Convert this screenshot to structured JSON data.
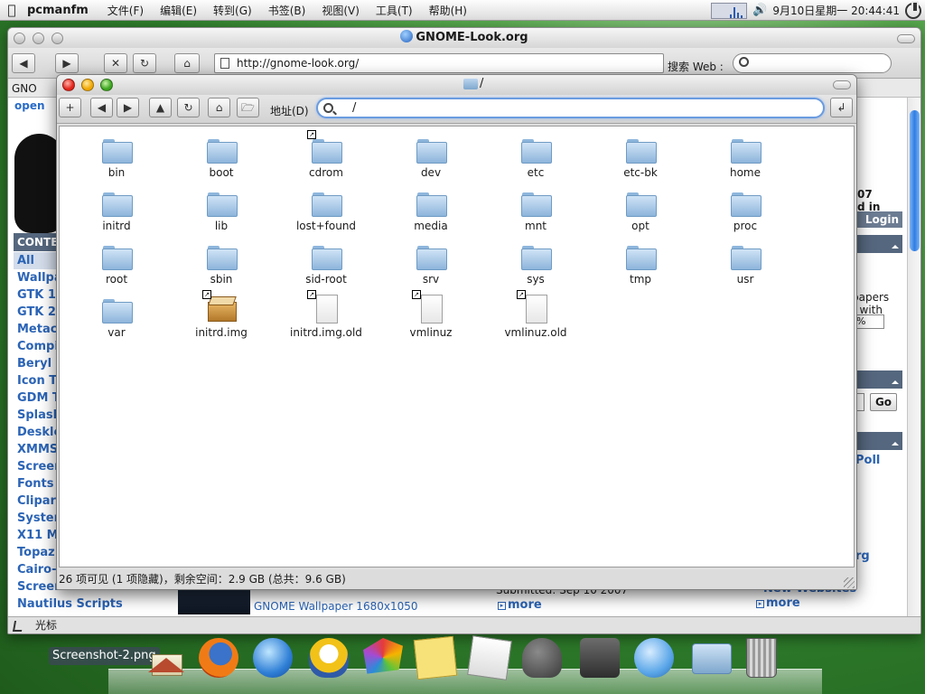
{
  "menubar": {
    "app_name": "pcmanfm",
    "items": [
      "文件(F)",
      "编辑(E)",
      "转到(G)",
      "书签(B)",
      "视图(V)",
      "工具(T)",
      "帮助(H)"
    ],
    "clock": "9月10日星期一 20:44:41",
    "icons": [
      "apple-icon",
      "cpu-monitor-icon",
      "volume-icon",
      "power-icon"
    ]
  },
  "browser": {
    "title": "GNOME-Look.org",
    "url": "http://gnome-look.org/",
    "search_label": "搜索 Web :",
    "search_placeholder": "",
    "tab_fragment": "GNO",
    "site_logo_fragment": "open",
    "contents_header": "CONTE",
    "categories": [
      "All",
      "Wallpa",
      "GTK 1.",
      "GTK 2.",
      "Metaci",
      "Compi",
      "Beryl",
      "Icon Th",
      "GDM T",
      "Splash",
      "Deskle",
      "XMMS",
      "Screen",
      "Fonts",
      "Clipart",
      "Systen",
      "X11 Mo",
      "Topaz",
      "Cairo-",
      "Screensavers",
      "Nautilus Scripts"
    ],
    "right_fragments": {
      "year": "07",
      "din": "d in",
      "login": "Login",
      "papers": "papers",
      "twith": "t with",
      "select_value": "%",
      "go": "Go",
      "poll": "Poll",
      "org": "rg",
      "new_websites": "New Websites",
      "more": "more"
    },
    "bottom": {
      "wallpaper_link": "GNOME Wallpaper 1680x1050",
      "submitted": "Submitted: Sep 10 2007",
      "more": "more"
    },
    "status_text": "光标"
  },
  "filemanager": {
    "title": "/",
    "address_label": "地址(D)",
    "address_value": "/",
    "toolbar_icons": [
      "new-tab-icon",
      "back-icon",
      "forward-icon",
      "up-icon",
      "reload-icon",
      "home-icon",
      "open-folder-icon"
    ],
    "files": [
      {
        "name": "bin",
        "type": "folder",
        "link": false
      },
      {
        "name": "boot",
        "type": "folder",
        "link": false
      },
      {
        "name": "cdrom",
        "type": "folder",
        "link": true
      },
      {
        "name": "dev",
        "type": "folder",
        "link": false
      },
      {
        "name": "etc",
        "type": "folder",
        "link": false
      },
      {
        "name": "etc-bk",
        "type": "folder",
        "link": false
      },
      {
        "name": "home",
        "type": "folder",
        "link": false
      },
      {
        "name": "initrd",
        "type": "folder",
        "link": false
      },
      {
        "name": "lib",
        "type": "folder",
        "link": false
      },
      {
        "name": "lost+found",
        "type": "folder",
        "link": false
      },
      {
        "name": "media",
        "type": "folder",
        "link": false
      },
      {
        "name": "mnt",
        "type": "folder",
        "link": false
      },
      {
        "name": "opt",
        "type": "folder",
        "link": false
      },
      {
        "name": "proc",
        "type": "folder",
        "link": false
      },
      {
        "name": "root",
        "type": "folder",
        "link": false
      },
      {
        "name": "sbin",
        "type": "folder",
        "link": false
      },
      {
        "name": "sid-root",
        "type": "folder",
        "link": false
      },
      {
        "name": "srv",
        "type": "folder",
        "link": false
      },
      {
        "name": "sys",
        "type": "folder",
        "link": false
      },
      {
        "name": "tmp",
        "type": "folder",
        "link": false
      },
      {
        "name": "usr",
        "type": "folder",
        "link": false
      },
      {
        "name": "var",
        "type": "folder",
        "link": false
      },
      {
        "name": "initrd.img",
        "type": "package",
        "link": true
      },
      {
        "name": "initrd.img.old",
        "type": "file",
        "link": true
      },
      {
        "name": "vmlinuz",
        "type": "file",
        "link": true
      },
      {
        "name": "vmlinuz.old",
        "type": "file",
        "link": true
      }
    ],
    "status": "26 项可见 (1 项隐藏)，剩余空间：2.9 GB (总共：9.6 GB)"
  },
  "dock": {
    "hover_label": "Screenshot-2.png",
    "items": [
      "home",
      "firefox",
      "globe",
      "pidgin",
      "gtk-theme",
      "notes",
      "text-editor",
      "gimp",
      "totem",
      "itunes",
      "folder",
      "trash"
    ]
  },
  "colors": {
    "accent": "#2b64b6",
    "header_bg": "#55677e",
    "address_focus": "#6a9be0"
  }
}
